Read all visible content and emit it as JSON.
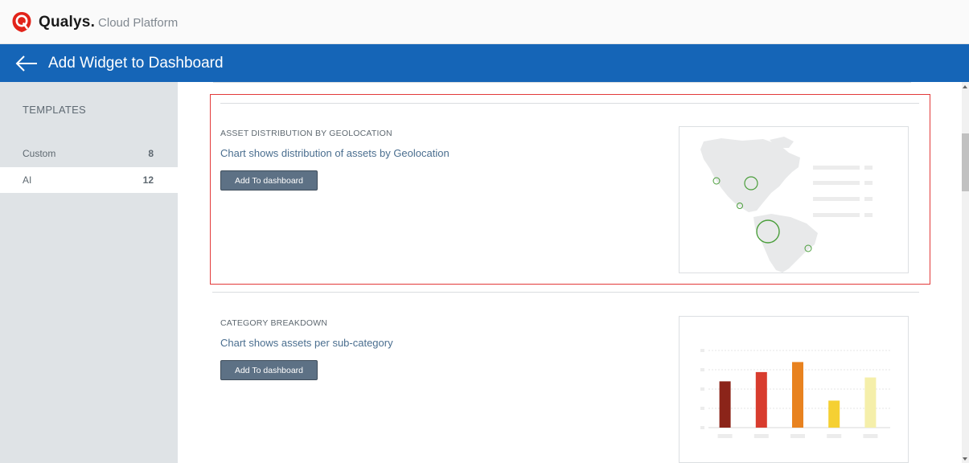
{
  "app": {
    "brand": "Qualys.",
    "product": "Cloud Platform",
    "brand_color": "#e2231a"
  },
  "header": {
    "title": "Add Widget to Dashboard",
    "back_icon": "arrow-left-icon",
    "bg_color": "#1565b7"
  },
  "sidebar": {
    "title": "TEMPLATES",
    "items": [
      {
        "label": "Custom",
        "count": "8",
        "active": false
      },
      {
        "label": "AI",
        "count": "12",
        "active": true
      }
    ]
  },
  "widgets": [
    {
      "label": "ASSET DISTRIBUTION BY GEOLOCATION",
      "description": "Chart shows distribution of assets by Geolocation",
      "button_label": "Add To dashboard",
      "preview": "world-map-bubble-preview",
      "selected": true
    },
    {
      "label": "CATEGORY BREAKDOWN",
      "description": "Chart shows assets per sub-category",
      "button_label": "Add To dashboard",
      "preview": "bar-chart-preview",
      "selected": false
    }
  ],
  "chart_data": {
    "type": "bar",
    "categories": [
      "",
      "",
      "",
      "",
      ""
    ],
    "values": [
      60,
      72,
      85,
      35,
      65
    ],
    "colors": [
      "#8b2419",
      "#d83c2e",
      "#e8821f",
      "#f5d033",
      "#f5efaa"
    ],
    "title": "",
    "xlabel": "",
    "ylabel": "",
    "ylim": [
      0,
      100
    ],
    "grid": true
  }
}
